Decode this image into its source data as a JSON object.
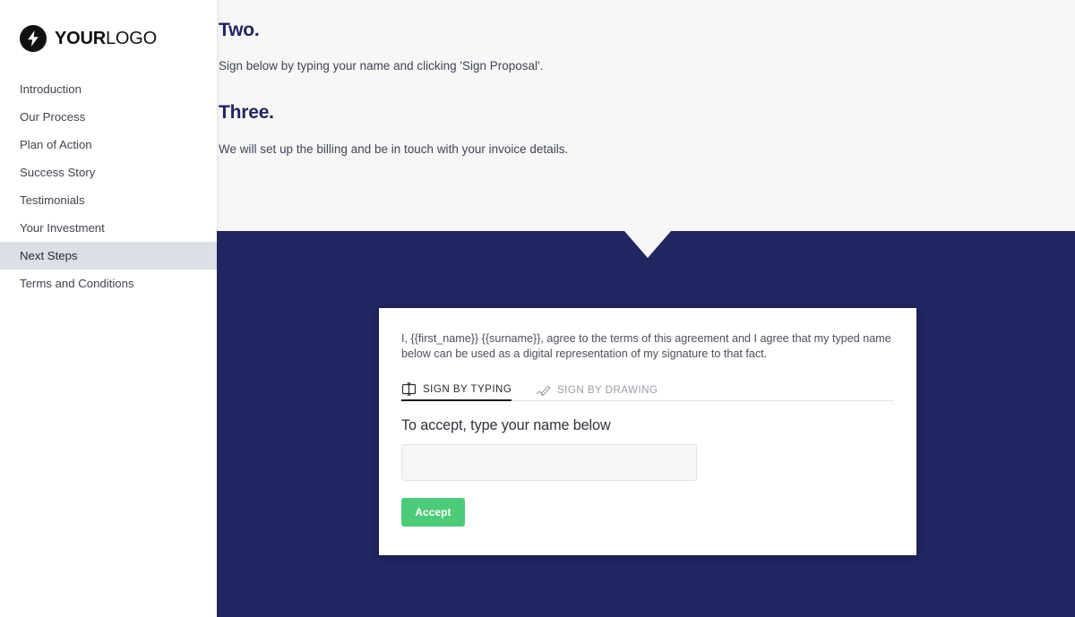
{
  "brand": {
    "logo_text_bold": "YOUR",
    "logo_text_light": "LOGO",
    "logo_icon": "lightning-bolt-icon"
  },
  "sidebar": {
    "items": [
      {
        "label": "Introduction",
        "active": false
      },
      {
        "label": "Our Process",
        "active": false
      },
      {
        "label": "Plan of Action",
        "active": false
      },
      {
        "label": "Success Story",
        "active": false
      },
      {
        "label": "Testimonials",
        "active": false
      },
      {
        "label": "Your Investment",
        "active": false
      },
      {
        "label": "Next Steps",
        "active": true
      },
      {
        "label": "Terms and Conditions",
        "active": false
      }
    ]
  },
  "steps": [
    {
      "heading": "Two.",
      "body": "Sign below by typing your name and clicking 'Sign Proposal'."
    },
    {
      "heading": "Three.",
      "body": "We will set up the billing and be in touch with your invoice details."
    }
  ],
  "signature_card": {
    "agreement_text": "I, {{first_name}} {{surname}}, agree to the terms of this agreement and I agree that my typed name below can be used as a digital representation of my signature to that fact.",
    "tabs": [
      {
        "label": "SIGN BY TYPING",
        "icon": "text-cursor-box-icon",
        "selected": true
      },
      {
        "label": "SIGN BY DRAWING",
        "icon": "pen-signature-icon",
        "selected": false
      }
    ],
    "accept_label": "To accept, type your name below",
    "name_input_value": "",
    "name_input_placeholder": "",
    "accept_button_label": "Accept"
  },
  "colors": {
    "navy": "#212560",
    "green_accept": "#4ecb79",
    "sidebar_active": "#dcdfe6",
    "content_bg": "#f7f7f8"
  }
}
